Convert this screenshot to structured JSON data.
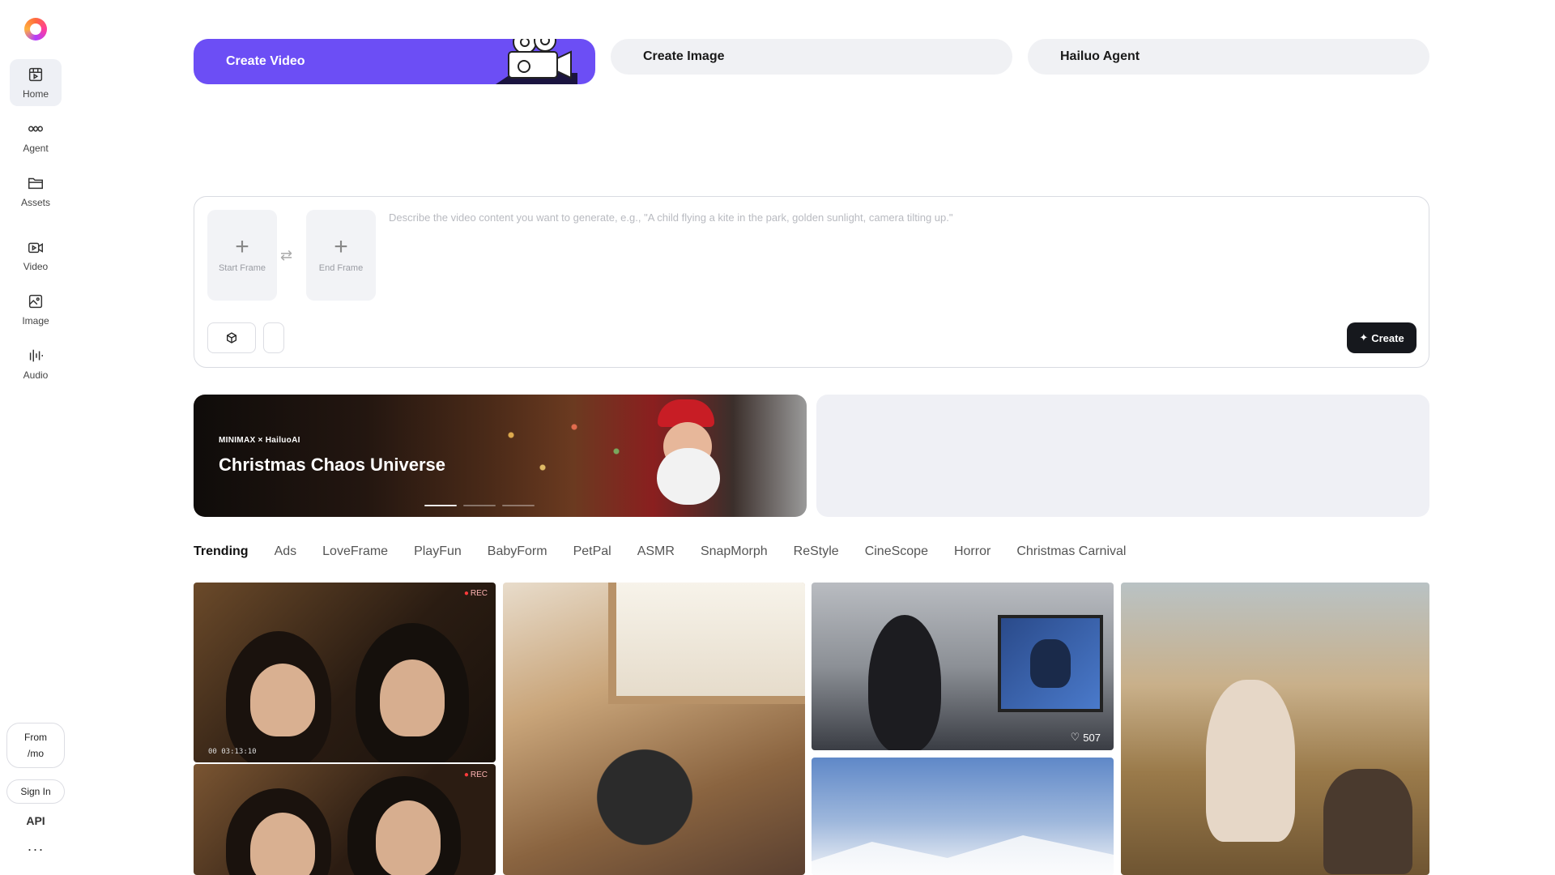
{
  "sidebar": {
    "items": [
      {
        "label": "Home",
        "icon": "home-icon"
      },
      {
        "label": "Agent",
        "icon": "infinity-icon"
      },
      {
        "label": "Assets",
        "icon": "folder-icon"
      },
      {
        "label": "Video",
        "icon": "video-icon"
      },
      {
        "label": "Image",
        "icon": "image-icon"
      },
      {
        "label": "Audio",
        "icon": "audio-waveform-icon"
      }
    ],
    "promo_line1": "From",
    "promo_line2": "/mo",
    "sign_in": "Sign In",
    "api": "API",
    "more": "···"
  },
  "modes": {
    "video": "Create Video",
    "image": "Create Image",
    "agent": "Hailuo Agent"
  },
  "prompt": {
    "start_frame": "Start Frame",
    "end_frame": "End Frame",
    "placeholder": "Describe the video content you want to generate, e.g., \"A child flying a kite in the park, golden sunlight, camera tilting up.\"",
    "value": "",
    "create_label": "Create"
  },
  "banner": {
    "brand": "MINIMAX × HailuoAI",
    "title": "Christmas Chaos Universe",
    "slide_count": 3,
    "active_slide": 1
  },
  "tabs": [
    "Trending",
    "Ads",
    "LoveFrame",
    "PlayFun",
    "BabyForm",
    "PetPal",
    "ASMR",
    "SnapMorph",
    "ReStyle",
    "CineScope",
    "Horror",
    "Christmas Carnival"
  ],
  "active_tab": "Trending",
  "gallery": {
    "tile1_rec": "REC",
    "tile1_time": "00 03:13:10",
    "tile1b_rec": "REC",
    "tile3_likes": "507"
  },
  "colors": {
    "accent": "#6c4ef5",
    "create_button": "#16181d"
  }
}
